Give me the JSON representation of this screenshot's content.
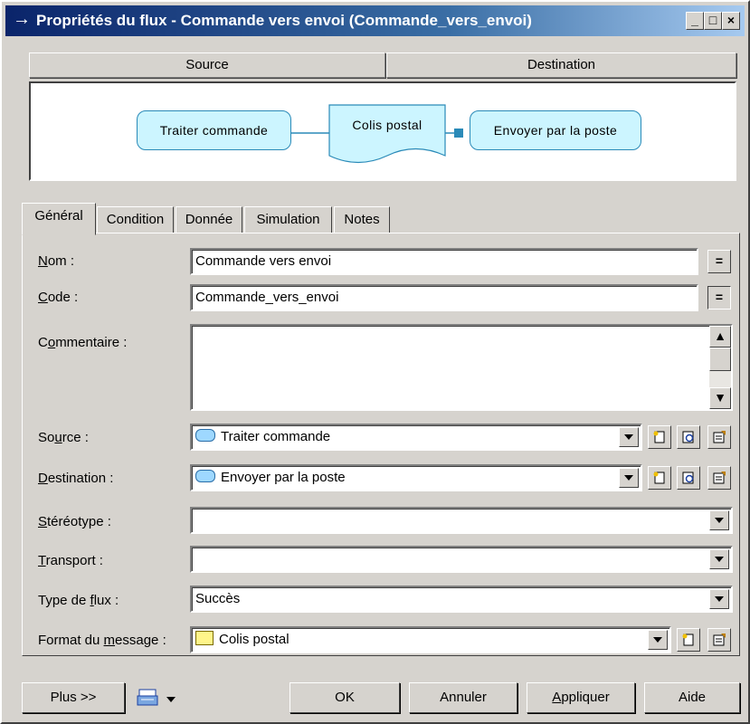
{
  "window": {
    "title": "Propriétés du flux - Commande vers envoi (Commande_vers_envoi)",
    "controls": [
      "_",
      "□",
      "×"
    ]
  },
  "header": {
    "source_label": "Source",
    "destination_label": "Destination"
  },
  "diagram": {
    "source_node": "Traiter commande",
    "message_node": "Colis postal",
    "destination_node": "Envoyer par la poste"
  },
  "tabs": [
    {
      "label": "Général",
      "active": true
    },
    {
      "label": "Condition"
    },
    {
      "label": "Donnée"
    },
    {
      "label": "Simulation"
    },
    {
      "label": "Notes"
    }
  ],
  "form": {
    "nom": {
      "label_pre": "",
      "label_u": "N",
      "label_post": "om :",
      "value": "Commande vers envoi",
      "btn": "="
    },
    "code": {
      "label_pre": "",
      "label_u": "C",
      "label_post": "ode :",
      "value": "Commande_vers_envoi",
      "btn": "="
    },
    "commentaire": {
      "label_pre": "C",
      "label_u": "o",
      "label_post": "mmentaire :",
      "value": ""
    },
    "source": {
      "label_pre": "So",
      "label_u": "u",
      "label_post": "rce :",
      "value": "Traiter commande"
    },
    "destination": {
      "label_pre": "",
      "label_u": "D",
      "label_post": "estination :",
      "value": "Envoyer par la poste"
    },
    "stereotype": {
      "label_pre": "",
      "label_u": "S",
      "label_post": "téréotype :",
      "value": ""
    },
    "transport": {
      "label_pre": "",
      "label_u": "T",
      "label_post": "ransport :",
      "value": ""
    },
    "type_flux": {
      "label_pre": "Type de ",
      "label_u": "f",
      "label_post": "lux :",
      "value": "Succès"
    },
    "format_message": {
      "label_pre": "Format du ",
      "label_u": "m",
      "label_post": "essage :",
      "value": "Colis postal"
    }
  },
  "footer": {
    "more_label": "Plus >>",
    "ok_label": "OK",
    "cancel_label": "Annuler",
    "apply_pre": "",
    "apply_u": "A",
    "apply_post": "ppliquer",
    "help_label": "Aide"
  },
  "colors": {
    "titlebar_start": "#0a246a",
    "titlebar_end": "#a6caf0",
    "node_fill": "#ccf5ff",
    "window_bg": "#d6d3ce"
  }
}
